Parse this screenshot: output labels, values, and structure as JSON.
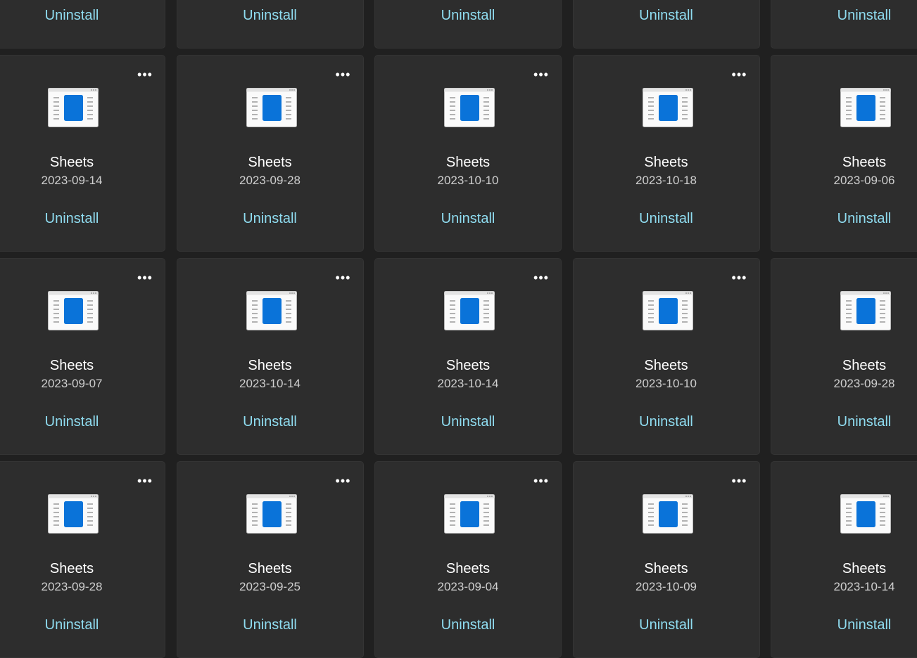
{
  "more_symbol": "•••",
  "uninstall_label": "Uninstall",
  "icon_name": "sheets-app-icon",
  "accent_color": "#8fdcf0",
  "rows": [
    [
      {
        "name": "",
        "date": "",
        "action": "Uninstall"
      },
      {
        "name": "",
        "date": "",
        "action": "Uninstall"
      },
      {
        "name": "",
        "date": "",
        "action": "Uninstall"
      },
      {
        "name": "",
        "date": "",
        "action": "Uninstall"
      },
      {
        "name": "",
        "date": "",
        "action": "Uninstall"
      }
    ],
    [
      {
        "name": "Sheets",
        "date": "2023-09-14",
        "action": "Uninstall"
      },
      {
        "name": "Sheets",
        "date": "2023-09-28",
        "action": "Uninstall"
      },
      {
        "name": "Sheets",
        "date": "2023-10-10",
        "action": "Uninstall"
      },
      {
        "name": "Sheets",
        "date": "2023-10-18",
        "action": "Uninstall"
      },
      {
        "name": "Sheets",
        "date": "2023-09-06",
        "action": "Uninstall"
      }
    ],
    [
      {
        "name": "Sheets",
        "date": "2023-09-07",
        "action": "Uninstall"
      },
      {
        "name": "Sheets",
        "date": "2023-10-14",
        "action": "Uninstall"
      },
      {
        "name": "Sheets",
        "date": "2023-10-14",
        "action": "Uninstall"
      },
      {
        "name": "Sheets",
        "date": "2023-10-10",
        "action": "Uninstall"
      },
      {
        "name": "Sheets",
        "date": "2023-09-28",
        "action": "Uninstall"
      }
    ],
    [
      {
        "name": "Sheets",
        "date": "2023-09-28",
        "action": "Uninstall"
      },
      {
        "name": "Sheets",
        "date": "2023-09-25",
        "action": "Uninstall"
      },
      {
        "name": "Sheets",
        "date": "2023-09-04",
        "action": "Uninstall"
      },
      {
        "name": "Sheets",
        "date": "2023-10-09",
        "action": "Uninstall"
      },
      {
        "name": "Sheets",
        "date": "2023-10-14",
        "action": "Uninstall"
      }
    ]
  ]
}
